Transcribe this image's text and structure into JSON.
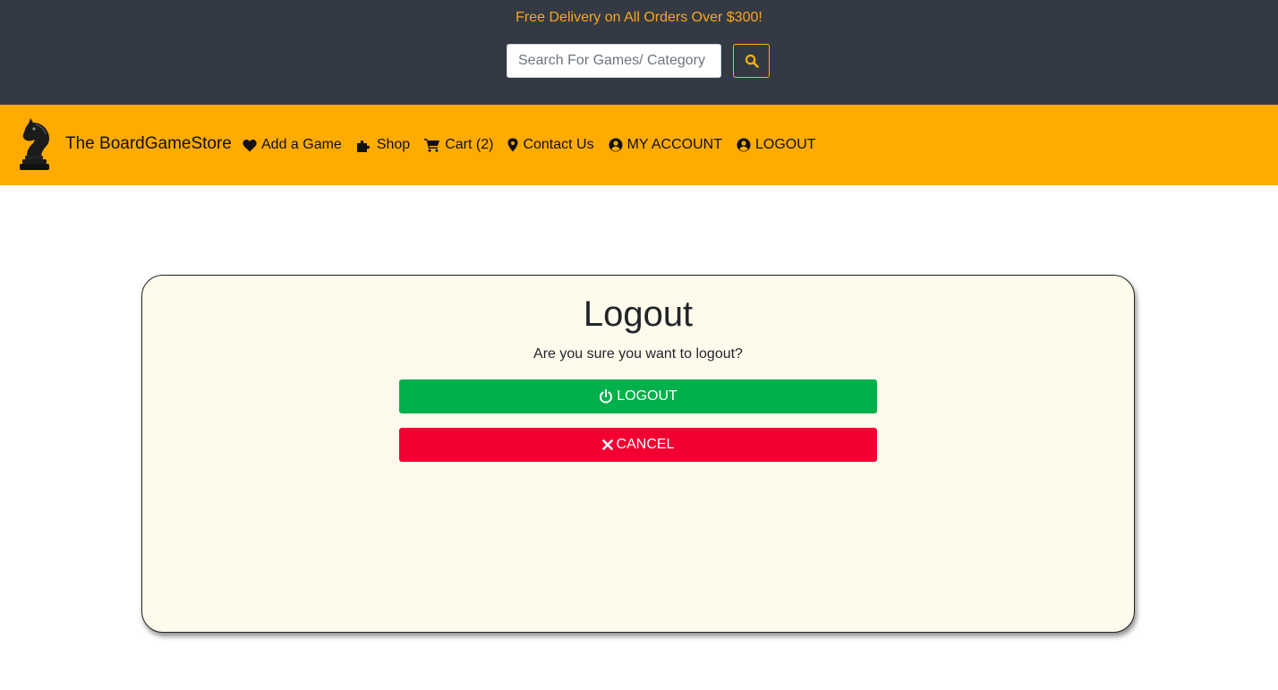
{
  "topbar": {
    "promo_text": "Free Delivery on All Orders Over $300!",
    "search_placeholder": "Search For Games/ Category",
    "search_value": "",
    "search_icon": "search-icon",
    "colors": {
      "background": "#343a44",
      "promo": "#f5a623",
      "search_button_border": "#f5b400"
    }
  },
  "navbar": {
    "brand": {
      "logo_icon": "chess-knight-icon",
      "name": "The BoardGameStore"
    },
    "links": [
      {
        "icon": "heart-icon",
        "label": "Add a Game"
      },
      {
        "icon": "puzzle-piece-icon",
        "label": "Shop"
      },
      {
        "icon": "shopping-cart-icon",
        "label": "Cart (2)"
      },
      {
        "icon": "map-marker-icon",
        "label": "Contact Us"
      },
      {
        "icon": "user-circle-icon",
        "label": "MY ACCOUNT"
      },
      {
        "icon": "user-circle-icon",
        "label": "LOGOUT"
      }
    ],
    "colors": {
      "background": "#ffab00"
    }
  },
  "logout_card": {
    "title": "Logout",
    "message": "Are you sure you want to logout?",
    "logout_button": {
      "icon": "power-icon",
      "label": "LOGOUT",
      "color": "#00b04b"
    },
    "cancel_button": {
      "icon": "times-icon",
      "label": "CANCEL",
      "color": "#f20032"
    },
    "colors": {
      "background": "#fffbec"
    }
  }
}
